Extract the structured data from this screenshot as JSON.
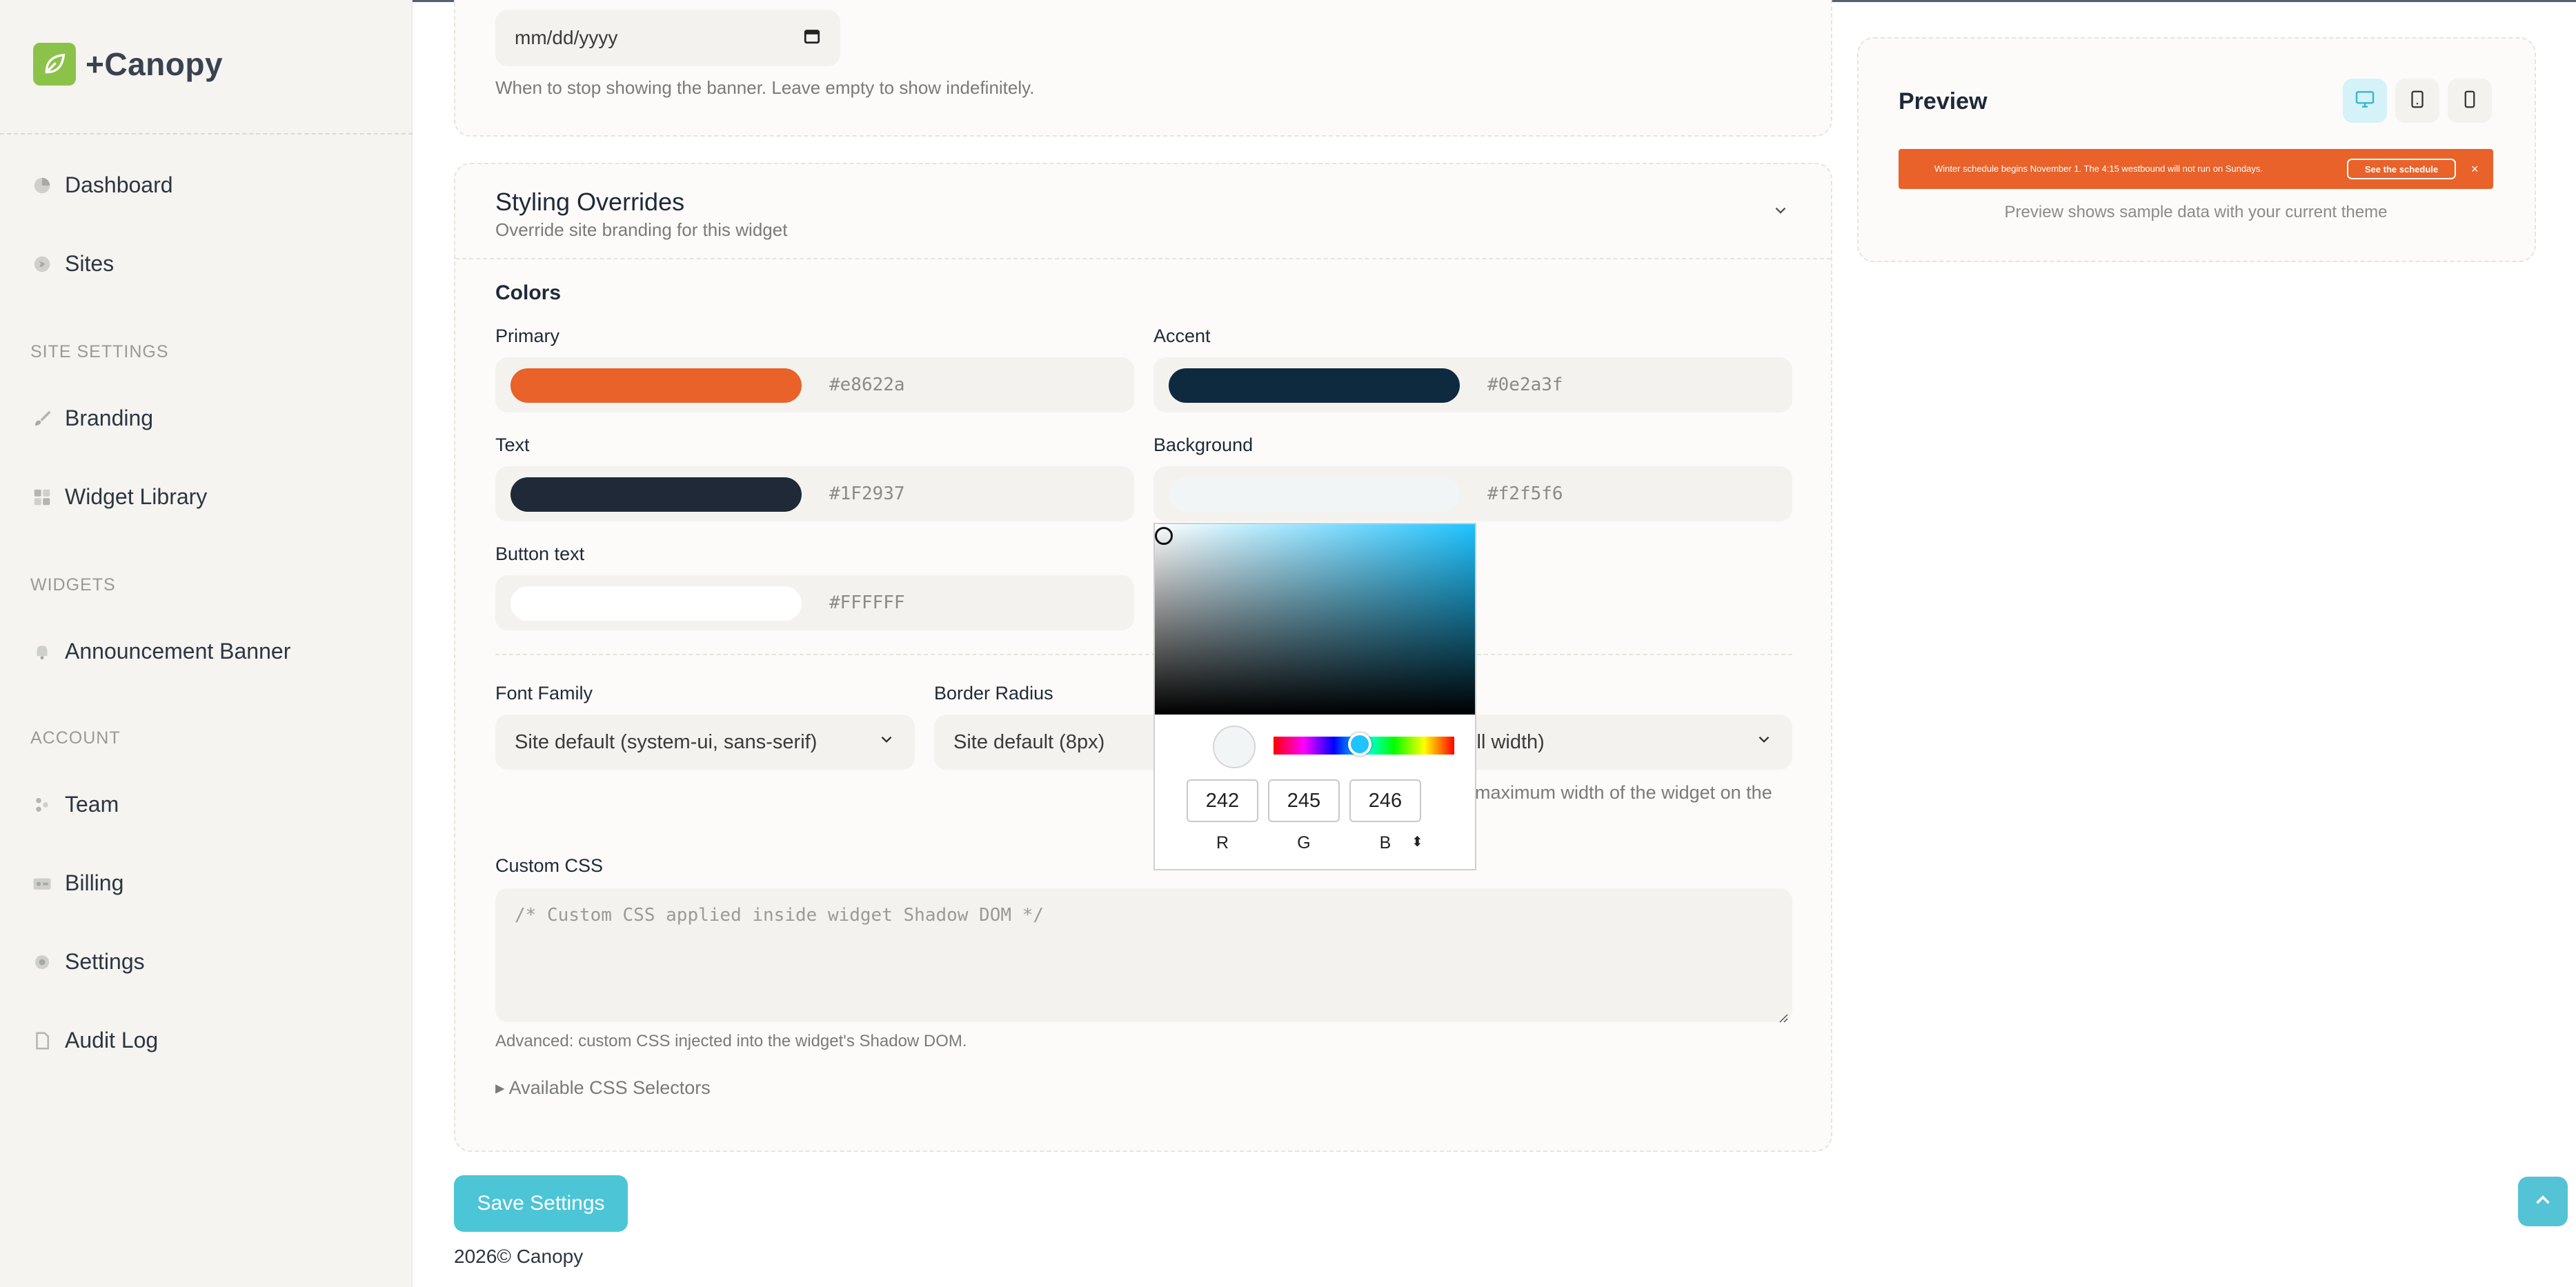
{
  "app": {
    "name": "+Canopy"
  },
  "sidebar": {
    "items_top": [
      {
        "label": "Dashboard",
        "icon": "pie-chart-icon"
      },
      {
        "label": "Sites",
        "icon": "globe-icon"
      }
    ],
    "site_settings_heading": "SITE SETTINGS",
    "site_settings": [
      {
        "label": "Branding",
        "icon": "brush-icon"
      },
      {
        "label": "Widget Library",
        "icon": "grid-icon"
      }
    ],
    "widgets_heading": "WIDGETS",
    "widgets": [
      {
        "label": "Announcement Banner",
        "icon": "bell-icon"
      }
    ],
    "account_heading": "ACCOUNT",
    "account": [
      {
        "label": "Team",
        "icon": "team-icon"
      },
      {
        "label": "Billing",
        "icon": "credit-card-icon"
      },
      {
        "label": "Settings",
        "icon": "gear-icon"
      },
      {
        "label": "Audit Log",
        "icon": "document-icon"
      }
    ]
  },
  "end_date": {
    "placeholder": "mm/dd/yyyy",
    "help": "When to stop showing the banner. Leave empty to show indefinitely."
  },
  "styling": {
    "title": "Styling Overrides",
    "subtitle": "Override site branding for this widget",
    "colors_heading": "Colors",
    "colors": {
      "primary": {
        "label": "Primary",
        "value": "#e8622a"
      },
      "accent": {
        "label": "Accent",
        "value": "#0e2a3f"
      },
      "text": {
        "label": "Text",
        "value": "#1F2937"
      },
      "background": {
        "label": "Background",
        "value": "#f2f5f6"
      },
      "button_text": {
        "label": "Button text",
        "value": "#FFFFFF"
      }
    },
    "font_family": {
      "label": "Font Family",
      "value": "Site default (system-ui, sans-serif)"
    },
    "border_radius": {
      "label": "Border Radius",
      "value": "Site default (8px)"
    },
    "max_width": {
      "value_partial": "efault (Full width)",
      "help_partial": "maximum width of the widget on the"
    },
    "custom_css": {
      "label": "Custom CSS",
      "placeholder": "/* Custom CSS applied inside widget Shadow DOM */",
      "help": "Advanced: custom CSS injected into the widget's Shadow DOM.",
      "selectors_toggle": "Available CSS Selectors"
    }
  },
  "color_picker": {
    "r": "242",
    "g": "245",
    "b": "246",
    "r_label": "R",
    "g_label": "G",
    "b_label": "B",
    "mode_toggle": "⬍",
    "hue_color": "#1fc3ff"
  },
  "save_label": "Save Settings",
  "footer": {
    "year": "2026©",
    "name": "Canopy"
  },
  "preview": {
    "title": "Preview",
    "banner_text": "Winter schedule begins November 1. The 4:15 westbound will not run on Sundays.",
    "banner_button": "See the schedule",
    "banner_close": "×",
    "note": "Preview shows sample data with your current theme"
  },
  "theme": {
    "brand_green": "#8bc34a",
    "cta_teal": "#4cc5d6",
    "orange": "#e8622a"
  }
}
